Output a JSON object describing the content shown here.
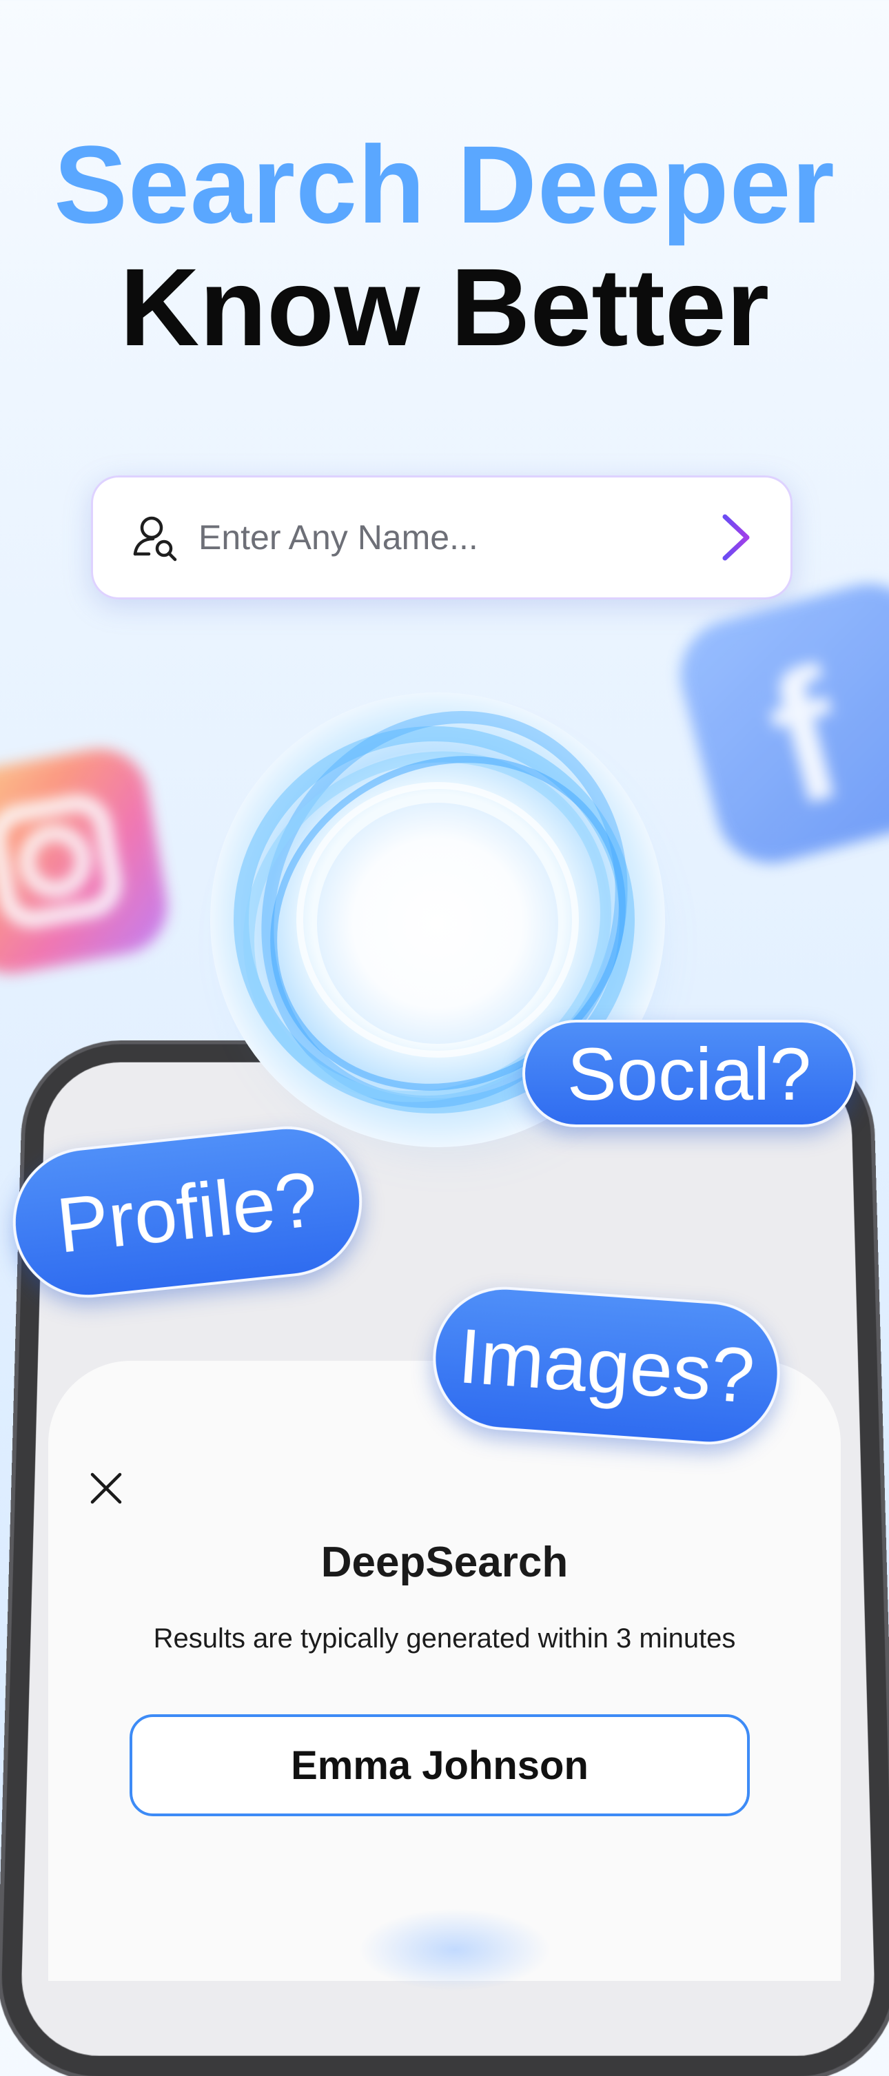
{
  "headline": {
    "line1": "Search Deeper",
    "line2": "Know Better"
  },
  "search": {
    "placeholder": "Enter Any Name...",
    "user_icon": "user-search-icon",
    "submit_icon": "arrow-right-icon"
  },
  "chips": {
    "social": "Social?",
    "profile": "Profile?",
    "images": "Images?"
  },
  "sheet": {
    "close_icon": "close-icon",
    "title": "DeepSearch",
    "subtitle": "Results are typically generated within 3 minutes",
    "name_value": "Emma Johnson"
  },
  "colors": {
    "headline_accent": "#5aa7ff",
    "chip_blue": "#3a7cf3",
    "field_border": "#3d8bf6",
    "arrow_purple": "#8b3ff0"
  }
}
